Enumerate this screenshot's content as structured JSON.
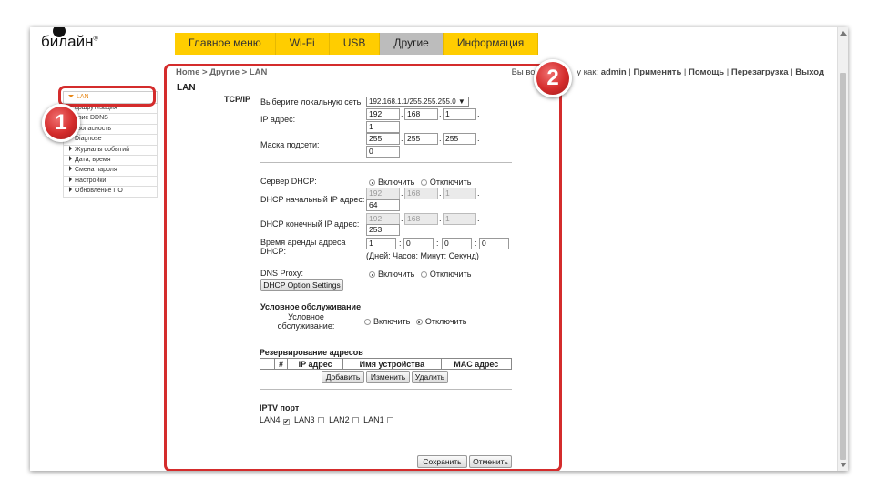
{
  "brand": {
    "name": "билайн",
    "mark": "®"
  },
  "nav": {
    "tabs": [
      {
        "label": "Главное меню"
      },
      {
        "label": "Wi-Fi"
      },
      {
        "label": "USB"
      },
      {
        "label": "Другие"
      },
      {
        "label": "Информация"
      }
    ],
    "active": "Другие"
  },
  "breadcrumb": {
    "home": "Home",
    "sep": " > ",
    "other": "Другие",
    "lan": "LAN"
  },
  "login": {
    "prefix": "Вы вош",
    "suffix": "у как:",
    "user": "admin",
    "apply": "Применить",
    "help": "Помощь",
    "reboot": "Перезагрузка",
    "logout": "Выход",
    "sep": " | "
  },
  "page_title": "LAN",
  "sidebar": {
    "active": "LAN",
    "items": [
      "аршрутизация",
      "рвис DDNS",
      "езопасность",
      "Diagnose",
      "Журналы событий",
      "Дата, время",
      "Смена пароля",
      "Настройки",
      "Обновление ПО"
    ]
  },
  "badges": {
    "one": "1",
    "two": "2"
  },
  "form": {
    "section": "TCP/IP",
    "select_net_label": "Выберите локальную сеть:",
    "select_net_value": "192.168.1.1/255.255.255.0 ▼",
    "ip_label": "IP адрес:",
    "ip": [
      "192",
      "168",
      "1",
      "1"
    ],
    "mask_label": "Маска подсети:",
    "mask": [
      "255",
      "255",
      "255",
      "0"
    ],
    "dhcp_label": "Сервер DHCP:",
    "on": "Включить",
    "off": "Отключить",
    "dhcp_start_label": "DHCP начальный IP адрес:",
    "dhcp_start": [
      "192",
      "168",
      "1",
      "64"
    ],
    "dhcp_end_label": "DHCP конечный IP адрес:",
    "dhcp_end": [
      "192",
      "168",
      "1",
      "253"
    ],
    "lease_label": "Время аренды адреса DHCP:",
    "lease": [
      "1",
      "0",
      "0",
      "0"
    ],
    "lease_hint": "(Дней: Часов: Минут: Секунд)",
    "dns_label": "DNS Proxy:",
    "dhcp_option_btn": "DHCP Option Settings",
    "cond_title": "Условное обслуживание",
    "cond_label": "Условное обслуживание:",
    "reserve_title": "Резервирование адресов",
    "table_headers": [
      "",
      "#",
      "IP адрес",
      "Имя устройства",
      "MAC адрес"
    ],
    "add": "Добавить",
    "edit": "Изменить",
    "delete": "Удалить",
    "iptv_title": "IPTV порт",
    "ports": [
      "LAN4",
      "LAN3",
      "LAN2",
      "LAN1"
    ],
    "port_checks": [
      "✔",
      "",
      "",
      ""
    ],
    "save": "Сохранить",
    "cancel": "Отменить"
  },
  "colors": {
    "accent": "#ffcd00",
    "highlight": "#d42c2c",
    "sidebar_active": "#e8891a"
  }
}
